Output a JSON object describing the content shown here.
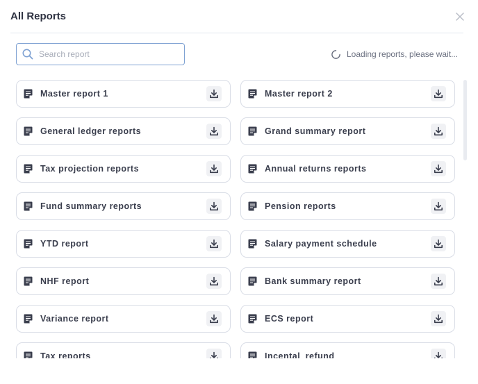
{
  "modal": {
    "title": "All Reports"
  },
  "search": {
    "placeholder": "Search report",
    "value": ""
  },
  "status": {
    "loading_text": "Loading reports, please wait..."
  },
  "reports": [
    {
      "label": "Master report 1"
    },
    {
      "label": "Master report 2"
    },
    {
      "label": "General ledger reports"
    },
    {
      "label": "Grand summary report"
    },
    {
      "label": "Tax projection reports"
    },
    {
      "label": "Annual returns reports"
    },
    {
      "label": "Fund summary reports"
    },
    {
      "label": "Pension reports"
    },
    {
      "label": "YTD report"
    },
    {
      "label": "Salary payment schedule"
    },
    {
      "label": "NHF report"
    },
    {
      "label": "Bank summary report"
    },
    {
      "label": "Variance report"
    },
    {
      "label": "ECS report"
    },
    {
      "label": "Tax reports"
    },
    {
      "label": "Incental_refund"
    }
  ],
  "icons": {
    "report": "document-icon",
    "download": "download-icon",
    "close": "close-icon",
    "search": "search-icon",
    "loading": "spinner-icon"
  },
  "colors": {
    "accent_border": "#7fa2d3",
    "card_border": "#d9dde6",
    "text": "#3a3e4d",
    "muted": "#6b7080"
  }
}
